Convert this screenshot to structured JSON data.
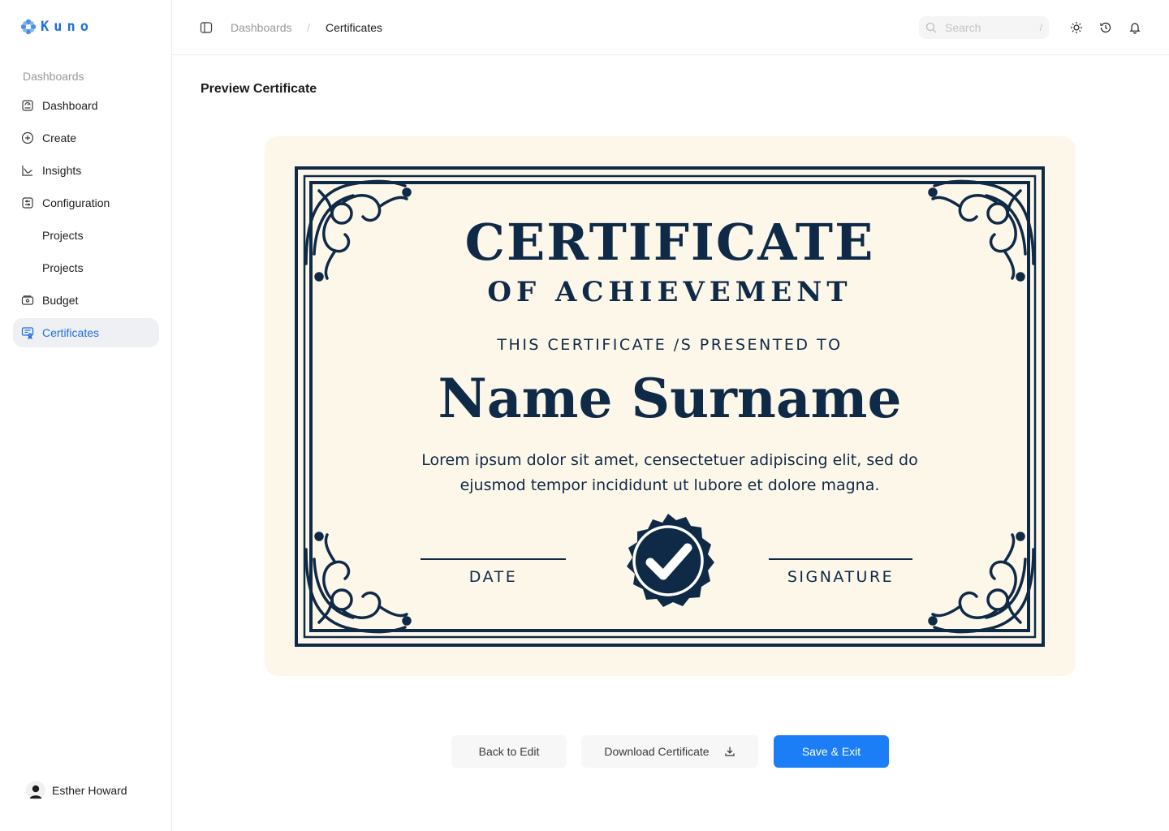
{
  "app": {
    "logo_text": "Kuno"
  },
  "sidebar": {
    "section_label": "Dashboards",
    "items": [
      {
        "label": "Dashboard",
        "icon": "dashboard-icon"
      },
      {
        "label": "Create",
        "icon": "plus-circle-icon"
      },
      {
        "label": "Insights",
        "icon": "chart-line-icon"
      },
      {
        "label": "Configuration",
        "icon": "settings-sliders-icon"
      },
      {
        "label": "Projects",
        "icon": ""
      },
      {
        "label": "Projects",
        "icon": ""
      },
      {
        "label": "Budget",
        "icon": "wallet-icon"
      },
      {
        "label": "Certificates",
        "icon": "certificate-icon",
        "active": true
      }
    ],
    "user": {
      "name": "Esther Howard"
    }
  },
  "header": {
    "breadcrumb": [
      "Dashboards",
      "Certificates"
    ],
    "breadcrumb_separator": "/",
    "search": {
      "placeholder": "Search",
      "shortcut": "/"
    },
    "icons": [
      "sun-icon",
      "history-icon",
      "bell-icon"
    ]
  },
  "main": {
    "title": "Preview Certificate",
    "certificate": {
      "title": "CERTIFICATE",
      "subtitle": "OF ACHIEVEMENT",
      "presented_to": "THIS CERTIFICATE /S PRESENTED TO",
      "name": "Name Surname",
      "body": "Lorem ipsum dolor sit amet, censectetuer adipiscing elit, sed do ejusmod tempor incididunt ut lubore et dolore magna.",
      "date_label": "DATE",
      "signature_label": "SIGNATURE",
      "colors": {
        "background": "#fdf7ea",
        "ink": "#0f2a47"
      }
    },
    "actions": {
      "back": "Back to Edit",
      "download": "Download Certificate",
      "save": "Save & Exit"
    }
  },
  "colors": {
    "accent": "#1b7ef7",
    "active_bg": "#eef0f3"
  }
}
